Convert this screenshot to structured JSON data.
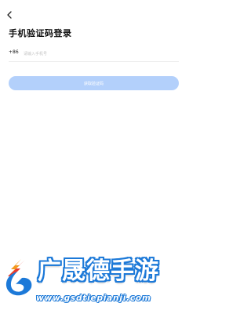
{
  "header": {
    "title": "手机验证码登录",
    "back_icon": "chevron-left-icon"
  },
  "login_form": {
    "country_code": "+86",
    "phone_placeholder": "请输入手机号",
    "phone_value": "",
    "get_code_label": "获取验证码"
  },
  "colors": {
    "button_disabled": "#b3d0fb",
    "divider": "#ececec",
    "watermark_blue": "#1c79d8"
  },
  "watermark": {
    "name": "广晟德手游",
    "url": "www.gsdtiepianji.com"
  }
}
